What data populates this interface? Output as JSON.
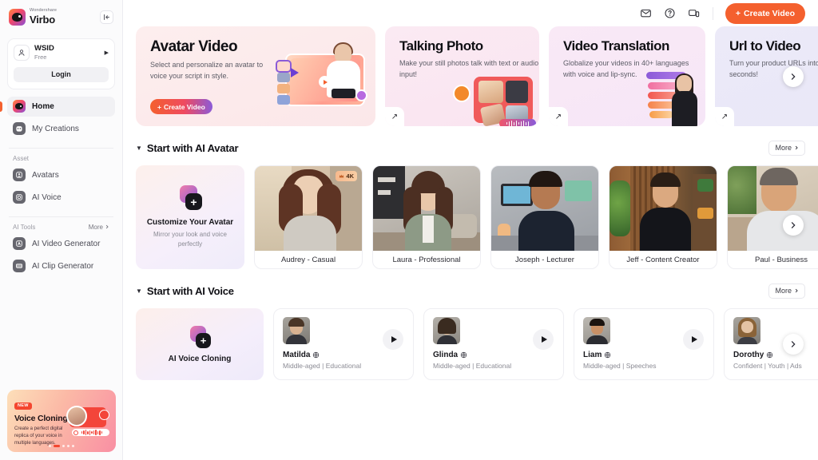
{
  "sidebar": {
    "brand": {
      "sup": "Wondershare",
      "name": "Virbo",
      "logo_icon": "virbo-logo-icon"
    },
    "collapse_icon": "panel-collapse-icon",
    "account": {
      "name": "WSID",
      "plan": "Free",
      "caret_icon": "chevron-right-icon",
      "avatar_icon": "user-icon",
      "login_label": "Login"
    },
    "nav": [
      {
        "label": "Home",
        "icon": "home-logo-icon",
        "active": true
      },
      {
        "label": "My Creations",
        "icon": "creations-icon",
        "active": false
      }
    ],
    "asset_group": {
      "title": "Asset",
      "items": [
        {
          "label": "Avatars",
          "icon": "avatar-icon"
        },
        {
          "label": "AI Voice",
          "icon": "voice-icon"
        }
      ]
    },
    "tools_group": {
      "title": "AI Tools",
      "more_label": "More",
      "more_icon": "chevron-right-icon",
      "items": [
        {
          "label": "AI Video Generator",
          "icon": "video-generator-icon"
        },
        {
          "label": "AI Clip Generator",
          "icon": "clip-generator-icon"
        }
      ]
    },
    "promo": {
      "badge": "NEW",
      "title": "Voice Cloning",
      "desc": "Create a perfect digital replica of your voice in multiple languages.",
      "dots": 5,
      "active_dot": 1
    }
  },
  "topbar": {
    "icons": [
      {
        "name": "mail-icon"
      },
      {
        "name": "help-circle-icon"
      },
      {
        "name": "desktop-app-icon"
      }
    ],
    "create_button": {
      "label": "Create Video",
      "plus_icon": "plus-icon",
      "color": "#f4602e"
    }
  },
  "hero": {
    "next_icon": "chevron-right-icon",
    "cards": [
      {
        "title": "Avatar Video",
        "desc": "Select and personalize an avatar to voice your script in style.",
        "cta": "Create Video",
        "cta_icon": "plus-icon",
        "bg": "#fdeeee"
      },
      {
        "title": "Talking Photo",
        "desc": "Make your still photos talk with text or audio input!",
        "arrow_icon": "arrow-up-right-icon",
        "bg": "#fbeaf3"
      },
      {
        "title": "Video Translation",
        "desc": "Globalize your videos in 40+ languages with voice and lip-sync.",
        "arrow_icon": "arrow-up-right-icon",
        "bg": "#f9e9f6"
      },
      {
        "title": "Url to Video",
        "desc": "Turn your product URLs into ads in seconds!",
        "arrow_icon": "arrow-up-right-icon",
        "bg": "#eceaf8"
      }
    ]
  },
  "avatar_section": {
    "title": "Start with AI Avatar",
    "caret_icon": "caret-down-icon",
    "more_label": "More",
    "more_icon": "chevron-right-icon",
    "next_icon": "chevron-right-icon",
    "customize": {
      "title": "Customize Your Avatar",
      "desc": "Mirror your look and voice perfectly",
      "icon": "add-avatar-icon"
    },
    "cards": [
      {
        "name": "Audrey - Casual",
        "badge": "4K",
        "badge_icon": "crown-icon"
      },
      {
        "name": "Laura - Professional"
      },
      {
        "name": "Joseph - Lecturer"
      },
      {
        "name": "Jeff - Content Creator"
      },
      {
        "name": "Paul - Business"
      }
    ]
  },
  "voice_section": {
    "title": "Start with AI Voice",
    "caret_icon": "caret-down-icon",
    "more_label": "More",
    "more_icon": "chevron-right-icon",
    "next_icon": "chevron-right-icon",
    "cloning": {
      "title": "AI Voice Cloning",
      "icon": "add-voice-icon"
    },
    "cards": [
      {
        "name": "Matilda",
        "globe_icon": "globe-icon",
        "meta": "Middle-aged | Educational",
        "play_icon": "play-icon"
      },
      {
        "name": "Glinda",
        "globe_icon": "globe-icon",
        "meta": "Middle-aged | Educational",
        "play_icon": "play-icon"
      },
      {
        "name": "Liam",
        "globe_icon": "globe-icon",
        "meta": "Middle-aged | Speeches",
        "play_icon": "play-icon"
      },
      {
        "name": "Dorothy",
        "globe_icon": "globe-icon",
        "meta": "Confident | Youth | Ads",
        "play_icon": "play-icon"
      }
    ]
  }
}
